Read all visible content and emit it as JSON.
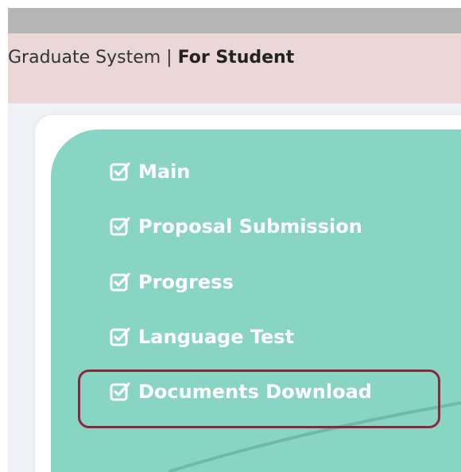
{
  "header": {
    "system_name": "Graduate System",
    "separator": "|",
    "role_label": "For Student"
  },
  "menu": {
    "items": [
      {
        "label": "Main",
        "icon": "checked-box-icon"
      },
      {
        "label": "Proposal Submission",
        "icon": "checked-box-icon"
      },
      {
        "label": "Progress",
        "icon": "checked-box-icon"
      },
      {
        "label": "Language Test",
        "icon": "checked-box-icon"
      },
      {
        "label": "Documents Download",
        "icon": "checked-box-icon",
        "highlighted": true
      }
    ]
  },
  "colors": {
    "top_strip": "#b5b5b5",
    "header_bg": "#ead7d7",
    "content_bg": "#eef2f6",
    "menu_panel": "#88d5c4",
    "menu_text": "#ffffff",
    "highlight_border": "#8b2742"
  }
}
